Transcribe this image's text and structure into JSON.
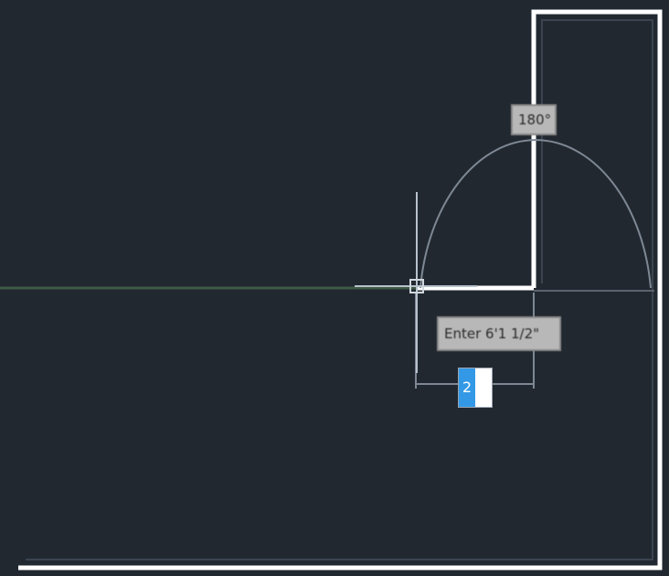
{
  "viewport": {
    "background": "#212830"
  },
  "colors": {
    "geometry": "#ffffff",
    "tracking_line": "#3e5a44",
    "dimension_line": "#7d8894",
    "selection": "#3399e6"
  },
  "tooltips": {
    "angle": "180°",
    "dimension": "Enter 6'1 1/2\""
  },
  "dynamic_input": {
    "value": "2"
  },
  "icons": {
    "cursor": "crosshair-cursor-icon"
  }
}
